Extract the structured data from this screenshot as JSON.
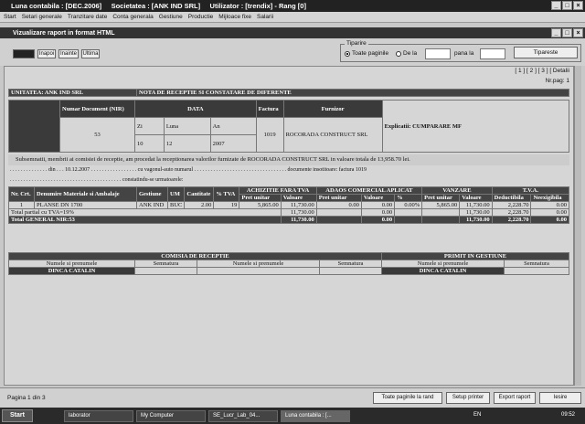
{
  "window": {
    "title": "Luna contabila : [DEC.2006]     Societatea : [ANK IND SRL]     Utilizator : [trendix] - Rang [0]"
  },
  "menu": [
    "Start",
    "Setari generale",
    "Tranzitare date",
    "Conta generala",
    "Gestiune",
    "Productie",
    "Mijloace fixe",
    "Salarii"
  ],
  "subwindow": {
    "title": "Vizualizare raport in format HTML"
  },
  "toolbar": {
    "back": "Inapoi",
    "next": "Inainte",
    "last": "Ultima"
  },
  "tiparire": {
    "legend": "Tiparire",
    "opt_all": "Toate paginile",
    "opt_from": "De la",
    "to_label": "pana la",
    "print_button": "Tipareste"
  },
  "report": {
    "pagelinks": "[ 1 ]  [ 2 ]  [ 3 ]  [ Detalii",
    "nrpag": "Nr.pag: 1",
    "unit": "UNITATEA: ANK IND SRL",
    "doc_title": "NOTA DE RECEPTIE SI CONSTATARE DE DIFERENTE",
    "h_numar": "Numar Document (NIR)",
    "h_data": "DATA",
    "h_factura": "Factura",
    "h_furnizor": "Furnizor",
    "h_zi": "Zi",
    "h_luna": "Luna",
    "h_an": "An",
    "numar": "53",
    "zi": "10",
    "luna": "12",
    "an": "2007",
    "factura": "1019",
    "furnizor": "ROCORADA CONSTRUCT SRL",
    "explicatii": "Explicatii: CUMPARARE MF",
    "text1": "Subsemnatii, membrii ai comisiei de receptie, am procedat la receptionarea valorilor furnizate de ROCORADA CONSTRUCT SRL in valoare totala de 13,958.70 lei.",
    "text2": ". . . . . . . . . . . . . . din . . . 10.12.2007 . . . . . . . . . . . . . . . . . cu vagonul-auto numarul . . . . . . . . . . . . . . . . . . . . . . . . . . . . . . . . . . documente insotitoare: factura 1019",
    "text3": ". . . . . . . . . . . . . . . . . . . . . . . . . . . . . . . . . . . . . . . . . constatindu-se urmatoarele:",
    "cols": {
      "nr": "Nr. Crt.",
      "den": "Denumire Materiale si Ambalaje",
      "gest": "Gestiune",
      "um": "UM",
      "cant": "Cantitate",
      "tva_pct": "% TVA",
      "achiz": "ACHIZITIE FARA TVA",
      "adaos": "ADAOS COMERCIAL APLICAT",
      "vanzare": "VANZARE",
      "tva": "T.V.A.",
      "pret_unitar": "Pret unitar",
      "valoare": "Valoare",
      "pct": "%",
      "deductibila": "Deductibila",
      "neexigibila": "Neexigibila"
    },
    "item": {
      "nr": "1",
      "den": "PLANSE DN 1700",
      "gest": "ANK IND",
      "um": "BUC",
      "cant": "2.00",
      "tva_pct": "19",
      "pret_achiz": "5,865.00",
      "val_achiz": "11,730.00",
      "pret_adaos": "0.00",
      "val_adaos": "0.00",
      "pct_adaos": "0.00%",
      "pret_vanz": "5,865.00",
      "val_vanz": "11,730.00",
      "deduct": "2,228.70",
      "neexig": "0.00"
    },
    "partial": {
      "label": "Total partial cu TVA=19%",
      "val_achiz": "11,730.00",
      "val_adaos": "0.00",
      "val_vanz": "11,730.00",
      "deduct": "2,228.70",
      "neexig": "0.00"
    },
    "general": {
      "label": "Total GENERAL NIR:53",
      "val_achiz": "11,730.00",
      "val_adaos": "0.00",
      "val_vanz": "11,730.00",
      "deduct": "2,228.70",
      "neexig": "0.00"
    },
    "comisia": "COMISIA DE RECEPTIE",
    "primit": "PRIMIT IN GESTIUNE",
    "nume": "Numele si prenumele",
    "semnatura": "Semnatura",
    "sig1": "DINCA CATALIN",
    "sig2": "DINCA CATALIN"
  },
  "status": {
    "page": "Pagina 1 din 3",
    "all_pages": "Toate paginile la rand",
    "setup": "Setup printer",
    "export": "Export raport",
    "exit": "Iesire"
  },
  "taskbar": {
    "start": "Start",
    "tasks": [
      "laborator",
      "My Computer",
      "SE_Lucr_Lab_04...",
      "Luna contabila : [..."
    ],
    "lang": "EN",
    "clock": "09:52"
  }
}
